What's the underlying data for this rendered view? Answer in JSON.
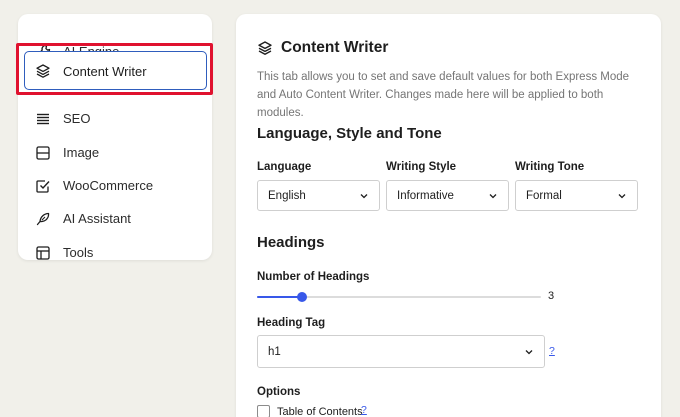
{
  "sidebar": {
    "items": [
      {
        "label": "AI Engine",
        "icon": "wrench-icon"
      },
      {
        "label": "Content Writer",
        "icon": "layers-icon",
        "active": true
      },
      {
        "label": "SEO",
        "icon": "lines-icon"
      },
      {
        "label": "Image",
        "icon": "image-icon"
      },
      {
        "label": "WooCommerce",
        "icon": "checkbox-icon"
      },
      {
        "label": "AI Assistant",
        "icon": "feather-icon"
      },
      {
        "label": "Tools",
        "icon": "layout-icon"
      }
    ]
  },
  "main": {
    "title": "Content Writer",
    "description": "This tab allows you to set and save default values for both Express Mode and Auto Content Writer. Changes made here will be applied to both modules.",
    "language_section": {
      "heading": "Language, Style and Tone",
      "language_label": "Language",
      "language_value": "English",
      "style_label": "Writing Style",
      "style_value": "Informative",
      "tone_label": "Writing Tone",
      "tone_value": "Formal"
    },
    "headings_section": {
      "heading": "Headings",
      "count_label": "Number of Headings",
      "count_value": "3",
      "count_fraction": 0.16,
      "tag_label": "Heading Tag",
      "tag_value": "h1",
      "help": "?"
    },
    "options": {
      "label": "Options",
      "toc_label": "Table of Contents",
      "toc_help": "?"
    }
  },
  "colors": {
    "accent": "#3858e9",
    "highlight": "#e0122f",
    "active_border": "#2f5dbd"
  }
}
